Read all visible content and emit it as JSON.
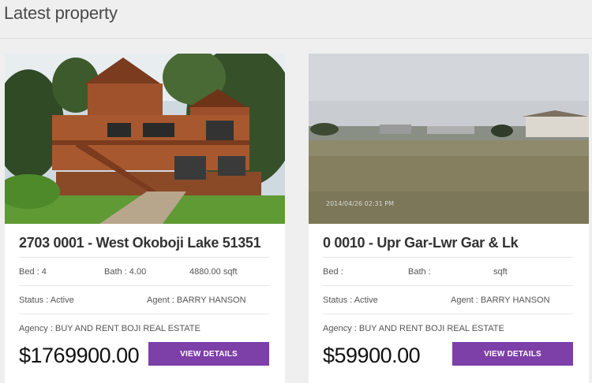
{
  "section": {
    "title": "Latest property"
  },
  "properties": [
    {
      "title": "2703 0001 - West Okoboji Lake 51351",
      "bed": "Bed : 4",
      "bath": "Bath : 4.00",
      "sqft": "4880.00 sqft",
      "status": "Status : Active",
      "agent": "Agent : BARRY HANSON",
      "agency": "Agency : BUY AND RENT BOJI REAL ESTATE",
      "price": "$1769900.00",
      "button": "VIEW DETAILS"
    },
    {
      "title": "0 0010 - Upr Gar-Lwr Gar & Lk",
      "bed": "Bed :",
      "bath": "Bath :",
      "sqft": "sqft",
      "status": "Status : Active",
      "agent": "Agent : BARRY HANSON",
      "agency": "Agency : BUY AND RENT BOJI REAL ESTATE",
      "price": "$59900.00",
      "button": "VIEW DETAILS",
      "photo_timestamp": "2014/04/26 02:31 PM"
    }
  ],
  "colors": {
    "button": "#7d3fa8",
    "background": "#efefef"
  }
}
